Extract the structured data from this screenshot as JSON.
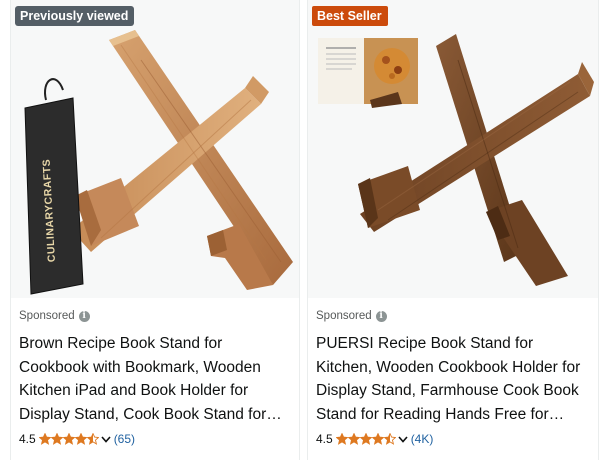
{
  "products": [
    {
      "badge": "Previously viewed",
      "sponsored_label": "Sponsored",
      "title": "Brown Recipe Book Stand for Cookbook with Bookmark, Wooden Kitchen iPad and Book Holder for Display Stand, Cook Book Stand for Reading Hands Free",
      "rating": "4.5",
      "rating_value": 4.5,
      "review_count": "(65)",
      "bookmark_text": "CULINARYCRAFTS"
    },
    {
      "badge": "Best Seller",
      "sponsored_label": "Sponsored",
      "title": "PUERSI Recipe Book Stand for Kitchen, Wooden Cookbook Holder for Display Stand, Farmhouse Cook Book Stand for Reading Hands Free for Kitchen",
      "rating": "4.5",
      "rating_value": 4.5,
      "review_count": "(4K)"
    }
  ],
  "colors": {
    "badge_previously_viewed": "#545e66",
    "badge_best_seller": "#cc4b0c",
    "star": "#de7921",
    "link": "#2162a1",
    "text": "#0f1111",
    "muted": "#565959"
  },
  "icons": {
    "info": "info-icon",
    "star": "star-icon",
    "chevron": "chevron-down-icon"
  }
}
